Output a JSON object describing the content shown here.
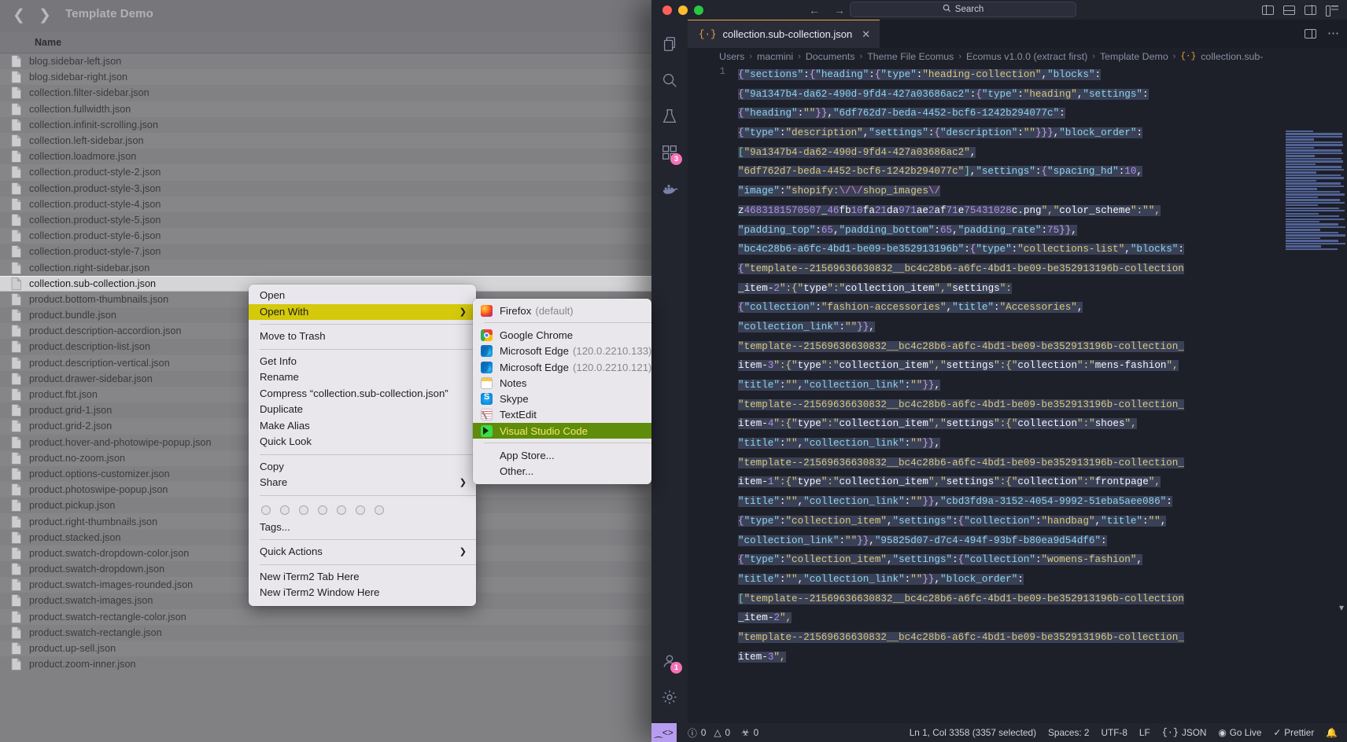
{
  "finder": {
    "title": "Template Demo",
    "back_icon": "chevron-left-icon",
    "forward_icon": "chevron-right-icon",
    "column_name": "Name",
    "files": [
      "blog.sidebar-left.json",
      "blog.sidebar-right.json",
      "collection.filter-sidebar.json",
      "collection.fullwidth.json",
      "collection.infinit-scrolling.json",
      "collection.left-sidebar.json",
      "collection.loadmore.json",
      "collection.product-style-2.json",
      "collection.product-style-3.json",
      "collection.product-style-4.json",
      "collection.product-style-5.json",
      "collection.product-style-6.json",
      "collection.product-style-7.json",
      "collection.right-sidebar.json",
      "collection.sub-collection.json",
      "product.bottom-thumbnails.json",
      "product.bundle.json",
      "product.description-accordion.json",
      "product.description-list.json",
      "product.description-vertical.json",
      "product.drawer-sidebar.json",
      "product.fbt.json",
      "product.grid-1.json",
      "product.grid-2.json",
      "product.hover-and-photowipe-popup.json",
      "product.no-zoom.json",
      "product.options-customizer.json",
      "product.photoswipe-popup.json",
      "product.pickup.json",
      "product.right-thumbnails.json",
      "product.stacked.json",
      "product.swatch-dropdown-color.json",
      "product.swatch-dropdown.json",
      "product.swatch-images-rounded.json",
      "product.swatch-images.json",
      "product.swatch-rectangle-color.json",
      "product.swatch-rectangle.json",
      "product.up-sell.json",
      "product.zoom-inner.json"
    ],
    "selected_index": 14
  },
  "context_menu": {
    "items": [
      {
        "label": "Open",
        "type": "item"
      },
      {
        "label": "Open With",
        "type": "item",
        "highlighted": true,
        "submenu": true
      },
      {
        "type": "separator"
      },
      {
        "label": "Move to Trash",
        "type": "item"
      },
      {
        "type": "separator"
      },
      {
        "label": "Get Info",
        "type": "item"
      },
      {
        "label": "Rename",
        "type": "item"
      },
      {
        "label": "Compress “collection.sub-collection.json”",
        "type": "item"
      },
      {
        "label": "Duplicate",
        "type": "item"
      },
      {
        "label": "Make Alias",
        "type": "item"
      },
      {
        "label": "Quick Look",
        "type": "item"
      },
      {
        "type": "separator"
      },
      {
        "label": "Copy",
        "type": "item"
      },
      {
        "label": "Share",
        "type": "item",
        "submenu": true
      },
      {
        "type": "separator"
      },
      {
        "type": "tags"
      },
      {
        "label": "Tags...",
        "type": "item"
      },
      {
        "type": "separator"
      },
      {
        "label": "Quick Actions",
        "type": "item",
        "submenu": true
      },
      {
        "type": "separator"
      },
      {
        "label": "New iTerm2 Tab Here",
        "type": "item"
      },
      {
        "label": "New iTerm2 Window Here",
        "type": "item"
      }
    ],
    "tag_count": 7,
    "highlight_color": "#d4c90b"
  },
  "open_with_submenu": {
    "apps": [
      {
        "label": "Firefox",
        "version": "(default)",
        "icon": "firefox-icon"
      },
      {
        "type": "separator"
      },
      {
        "label": "Google Chrome",
        "version": "",
        "icon": "chrome-icon"
      },
      {
        "label": "Microsoft Edge",
        "version": "(120.0.2210.133)",
        "icon": "edge-icon"
      },
      {
        "label": "Microsoft Edge",
        "version": "(120.0.2210.121)",
        "icon": "edge-icon"
      },
      {
        "label": "Notes",
        "version": "",
        "icon": "notes-icon"
      },
      {
        "label": "Skype",
        "version": "",
        "icon": "skype-icon"
      },
      {
        "label": "TextEdit",
        "version": "",
        "icon": "textedit-icon"
      },
      {
        "label": "Visual Studio Code",
        "version": "",
        "icon": "vscode-icon",
        "highlighted": true
      },
      {
        "type": "separator"
      },
      {
        "label": "App Store...",
        "noicon": true
      },
      {
        "label": "Other...",
        "noicon": true
      }
    ],
    "highlight_color": "#5f8c0a",
    "highlight_text_color": "#f3e96b"
  },
  "vscode": {
    "titlebar": {
      "search_placeholder": "Search",
      "search_icon": "magnifier-icon",
      "back_icon": "arrow-left-icon",
      "forward_icon": "arrow-right-icon",
      "layout_icons": [
        "toggle-primary-sidebar-icon",
        "toggle-panel-icon",
        "toggle-secondary-sidebar-icon",
        "customize-layout-icon"
      ]
    },
    "activity_bar": {
      "items": [
        {
          "name": "explorer-icon",
          "badge": ""
        },
        {
          "name": "search-icon",
          "badge": ""
        },
        {
          "name": "testing-icon",
          "badge": ""
        },
        {
          "name": "extensions-icon",
          "badge": "3"
        },
        {
          "name": "docker-icon",
          "badge": ""
        }
      ],
      "bottom_items": [
        {
          "name": "accounts-icon",
          "badge": "1"
        },
        {
          "name": "settings-gear-icon",
          "badge": ""
        }
      ]
    },
    "tab": {
      "json_icon": "{·}",
      "label": "collection.sub-collection.json",
      "close_icon": "close-icon",
      "actions": [
        "split-editor-icon",
        "more-actions-icon"
      ]
    },
    "breadcrumb": [
      "Users",
      "macmini",
      "Documents",
      "Theme File Ecomus",
      "Ecomus v1.0.0 (extract first)",
      "Template Demo",
      "collection.sub-"
    ],
    "line_number": "1",
    "code_lines": [
      "{\"sections\":{\"heading\":{\"type\":\"heading-collection\",\"blocks\":",
      "{\"9a1347b4-da62-490d-9fd4-427a03686ac2\":{\"type\":\"heading\",\"settings\":",
      "{\"heading\":\"\"}},\"6df762d7-beda-4452-bcf6-1242b294077c\":",
      "{\"type\":\"description\",\"settings\":{\"description\":\"\"}}},\"block_order\":",
      "[\"9a1347b4-da62-490d-9fd4-427a03686ac2\",",
      "\"6df762d7-beda-4452-bcf6-1242b294077c\"],\"settings\":{\"spacing_hd\":10,",
      "\"image\":\"shopify:\\/\\/shop_images\\/",
      "z4683181570507_46fb10fa21da971ae2af71e75431028c.png\",\"color_scheme\":\"\",",
      "\"padding_top\":65,\"padding_bottom\":65,\"padding_rate\":75}},",
      "\"bc4c28b6-a6fc-4bd1-be09-be352913196b\":{\"type\":\"collections-list\",\"blocks\":",
      "{\"template--21569636630832__bc4c28b6-a6fc-4bd1-be09-be352913196b-collection",
      "_item-2\":{\"type\":\"collection_item\",\"settings\":",
      "{\"collection\":\"fashion-accessories\",\"title\":\"Accessories\",",
      "\"collection_link\":\"\"}},",
      "\"template--21569636630832__bc4c28b6-a6fc-4bd1-be09-be352913196b-collection_",
      "item-3\":{\"type\":\"collection_item\",\"settings\":{\"collection\":\"mens-fashion\",",
      "\"title\":\"\",\"collection_link\":\"\"}},",
      "\"template--21569636630832__bc4c28b6-a6fc-4bd1-be09-be352913196b-collection_",
      "item-4\":{\"type\":\"collection_item\",\"settings\":{\"collection\":\"shoes\",",
      "\"title\":\"\",\"collection_link\":\"\"}},",
      "\"template--21569636630832__bc4c28b6-a6fc-4bd1-be09-be352913196b-collection_",
      "item-1\":{\"type\":\"collection_item\",\"settings\":{\"collection\":\"frontpage\",",
      "\"title\":\"\",\"collection_link\":\"\"}},\"cbd3fd9a-3152-4054-9992-51eba5aee086\":",
      "{\"type\":\"collection_item\",\"settings\":{\"collection\":\"handbag\",\"title\":\"\",",
      "\"collection_link\":\"\"}},\"95825d07-d7c4-494f-93bf-b80ea9d54df6\":",
      "{\"type\":\"collection_item\",\"settings\":{\"collection\":\"womens-fashion\",",
      "\"title\":\"\",\"collection_link\":\"\"}},\"block_order\":",
      "[\"template--21569636630832__bc4c28b6-a6fc-4bd1-be09-be352913196b-collection",
      "_item-2\",",
      "\"template--21569636630832__bc4c28b6-a6fc-4bd1-be09-be352913196b-collection_",
      "item-3\","
    ],
    "status_bar": {
      "remote_icon": "remote-window-icon",
      "errors_icon": "error-circle-icon",
      "errors": "0",
      "warnings_icon": "warning-triangle-icon",
      "warnings": "0",
      "ports_icon": "radio-tower-icon",
      "ports": "0",
      "cursor_position": "Ln 1, Col 3358 (3357 selected)",
      "indentation": "Spaces: 2",
      "encoding": "UTF-8",
      "eol": "LF",
      "language_icon": "json-braces-icon",
      "language": "JSON",
      "golive_icon": "broadcast-icon",
      "golive": "Go Live",
      "prettier_icon": "check-check-icon",
      "prettier": "Prettier",
      "bell_icon": "bell-icon"
    }
  }
}
